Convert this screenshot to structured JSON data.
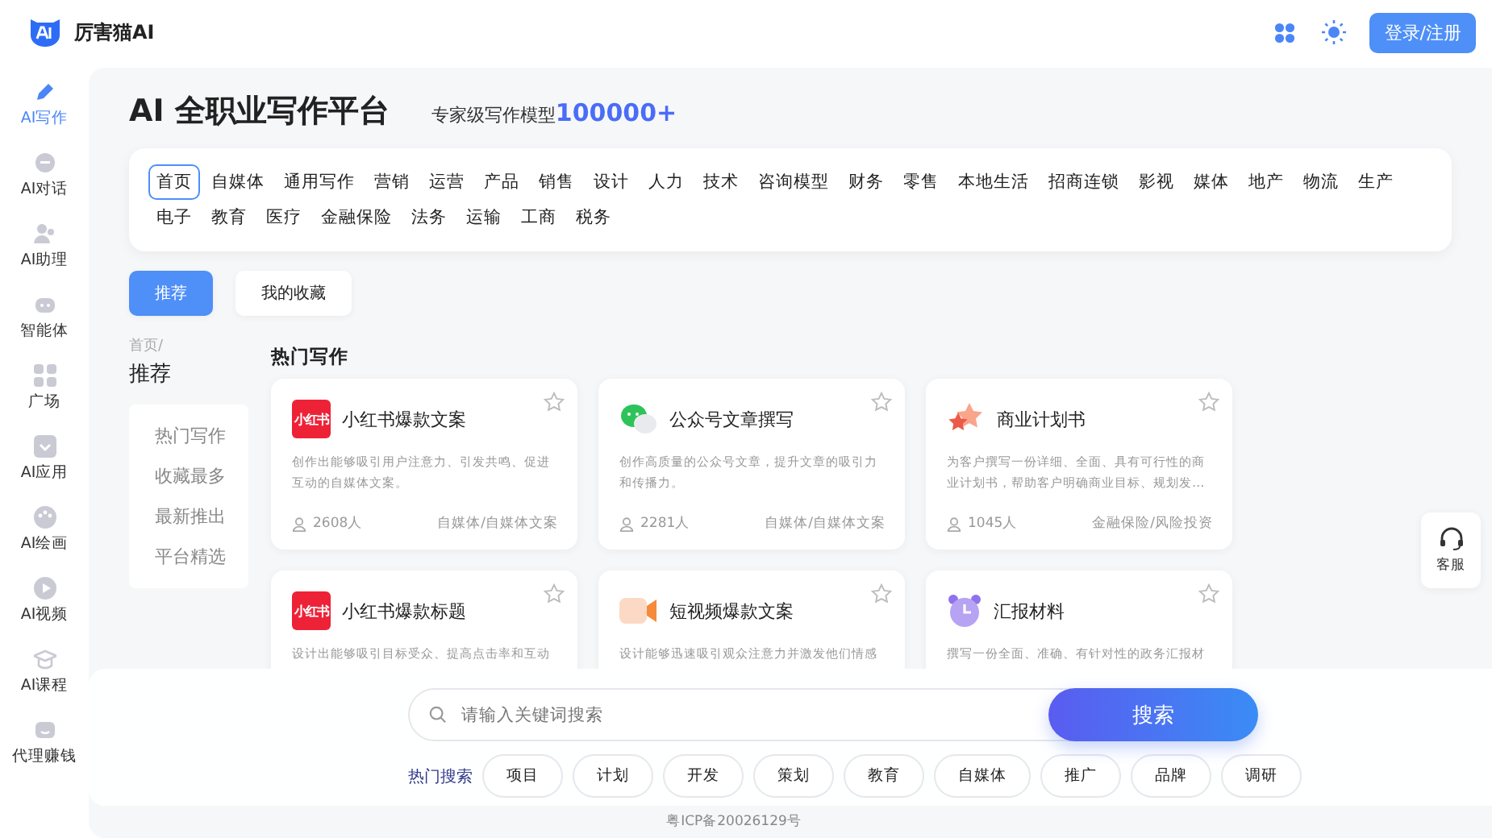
{
  "header": {
    "brand": "厉害猫AI",
    "login_button": "登录/注册"
  },
  "sidebar": {
    "items": [
      {
        "label": "AI写作",
        "selected": true
      },
      {
        "label": "AI对话",
        "selected": false
      },
      {
        "label": "AI助理",
        "selected": false
      },
      {
        "label": "智能体",
        "selected": false
      },
      {
        "label": "广场",
        "selected": false
      },
      {
        "label": "AI应用",
        "selected": false
      },
      {
        "label": "AI绘画",
        "selected": false
      },
      {
        "label": "AI视频",
        "selected": false
      },
      {
        "label": "AI课程",
        "selected": false
      },
      {
        "label": "代理赚钱",
        "selected": false
      }
    ]
  },
  "hero": {
    "title": "AI 全职业写作平台",
    "subtitle": "专家级写作模型",
    "highlight": "100000+"
  },
  "categories": [
    {
      "label": "首页",
      "selected": true
    },
    {
      "label": "自媒体",
      "selected": false
    },
    {
      "label": "通用写作",
      "selected": false
    },
    {
      "label": "营销",
      "selected": false
    },
    {
      "label": "运营",
      "selected": false
    },
    {
      "label": "产品",
      "selected": false
    },
    {
      "label": "销售",
      "selected": false
    },
    {
      "label": "设计",
      "selected": false
    },
    {
      "label": "人力",
      "selected": false
    },
    {
      "label": "技术",
      "selected": false
    },
    {
      "label": "咨询模型",
      "selected": false
    },
    {
      "label": "财务",
      "selected": false
    },
    {
      "label": "零售",
      "selected": false
    },
    {
      "label": "本地生活",
      "selected": false
    },
    {
      "label": "招商连锁",
      "selected": false
    },
    {
      "label": "影视",
      "selected": false
    },
    {
      "label": "媒体",
      "selected": false
    },
    {
      "label": "地产",
      "selected": false
    },
    {
      "label": "物流",
      "selected": false
    },
    {
      "label": "生产",
      "selected": false
    },
    {
      "label": "电子",
      "selected": false
    },
    {
      "label": "教育",
      "selected": false
    },
    {
      "label": "医疗",
      "selected": false
    },
    {
      "label": "金融保险",
      "selected": false
    },
    {
      "label": "法务",
      "selected": false
    },
    {
      "label": "运输",
      "selected": false
    },
    {
      "label": "工商",
      "selected": false
    },
    {
      "label": "税务",
      "selected": false
    }
  ],
  "tabs": [
    {
      "label": "推荐",
      "selected": true
    },
    {
      "label": "我的收藏",
      "selected": false
    }
  ],
  "breadcrumb": "首页/",
  "section_title": "推荐",
  "filters": [
    "热门写作",
    "收藏最多",
    "最新推出",
    "平台精选"
  ],
  "cards_heading": "热门写作",
  "cards": [
    {
      "kind": "xhs",
      "badge": "小红书",
      "title": "小红书爆款文案",
      "desc": "创作出能够吸引用户注意力、引发共鸣、促进互动的自媒体文案。",
      "users": "2608人",
      "category": "自媒体/自媒体文案"
    },
    {
      "kind": "wechat",
      "title": "公众号文章撰写",
      "desc": "创作高质量的公众号文章，提升文章的吸引力和传播力。",
      "users": "2281人",
      "category": "自媒体/自媒体文案"
    },
    {
      "kind": "star",
      "title": "商业计划书",
      "desc": "为客户撰写一份详细、全面、具有可行性的商业计划书，帮助客户明确商业目标、规划发…",
      "users": "1045人",
      "category": "金融保险/风险投资"
    },
    {
      "kind": "xhs",
      "badge": "小红书",
      "title": "小红书爆款标题",
      "desc": "设计出能够吸引目标受众、提高点击率和互动"
    },
    {
      "kind": "video",
      "title": "短视频爆款文案",
      "desc": "设计能够迅速吸引观众注意力并激发他们情感"
    },
    {
      "kind": "clock",
      "title": "汇报材料",
      "desc": "撰写一份全面、准确、有针对性的政务汇报材"
    }
  ],
  "service": "客服",
  "search": {
    "placeholder": "请输入关键词搜索",
    "button": "搜索",
    "hot_label": "热门搜索",
    "hot": [
      "项目",
      "计划",
      "开发",
      "策划",
      "教育",
      "自媒体",
      "推广",
      "品牌",
      "调研"
    ]
  },
  "footer": "粤ICP备20026129号"
}
